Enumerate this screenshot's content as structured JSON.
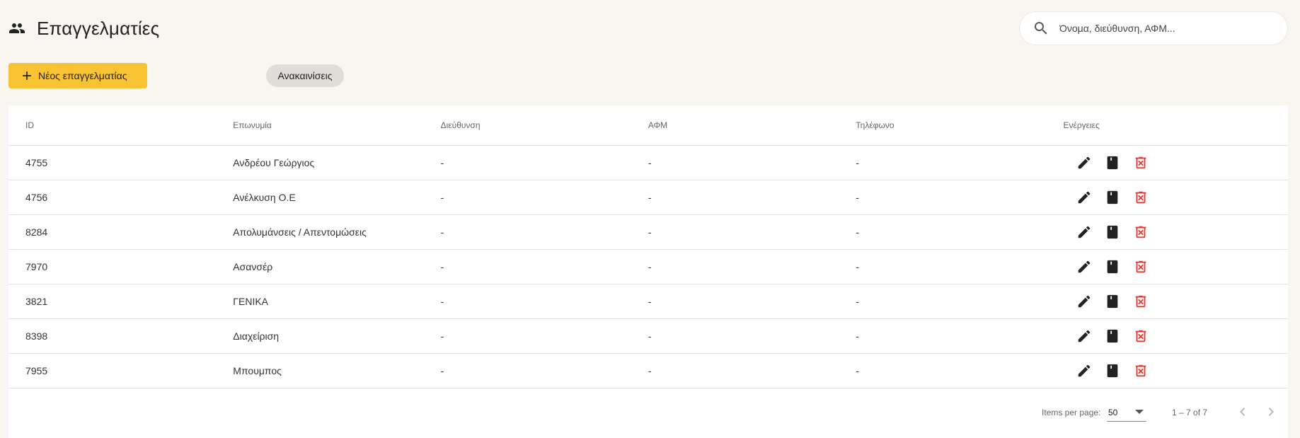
{
  "header": {
    "title": "Επαγγελματίες",
    "title_icon": "people-icon",
    "search_placeholder": "Όνομα, διεύθυνση, ΑΦΜ..."
  },
  "toolbar": {
    "new_button_label": "Νέος επαγγελματίας",
    "chip_label": "Ανακαινίσεις"
  },
  "colors": {
    "accent": "#f8c233",
    "delete": "#e53935",
    "background": "#f9f6f1"
  },
  "table": {
    "columns": [
      "ID",
      "Επωνυμία",
      "Διεύθυνση",
      "ΑΦΜ",
      "Τηλέφωνο",
      "Ενέργειες"
    ],
    "rows": [
      {
        "id": "4755",
        "name": "Ανδρέου Γεώργιος",
        "address": "-",
        "afm": "-",
        "phone": "-"
      },
      {
        "id": "4756",
        "name": "Ανέλκυση Ο.Ε",
        "address": "-",
        "afm": "-",
        "phone": "-"
      },
      {
        "id": "8284",
        "name": "Απολυμάνσεις / Απεντομώσεις",
        "address": "-",
        "afm": "-",
        "phone": "-"
      },
      {
        "id": "7970",
        "name": "Ασανσέρ",
        "address": "-",
        "afm": "-",
        "phone": "-"
      },
      {
        "id": "3821",
        "name": "ΓΕΝΙΚΑ",
        "address": "-",
        "afm": "-",
        "phone": "-"
      },
      {
        "id": "8398",
        "name": "Διαχείριση",
        "address": "-",
        "afm": "-",
        "phone": "-"
      },
      {
        "id": "7955",
        "name": "Μπουμπος",
        "address": "-",
        "afm": "-",
        "phone": "-"
      }
    ],
    "row_action_icons": [
      "edit-icon",
      "book-icon",
      "delete-icon"
    ]
  },
  "paginator": {
    "items_per_page_label": "Items per page:",
    "items_per_page": "50",
    "range": "1 – 7 of 7"
  }
}
